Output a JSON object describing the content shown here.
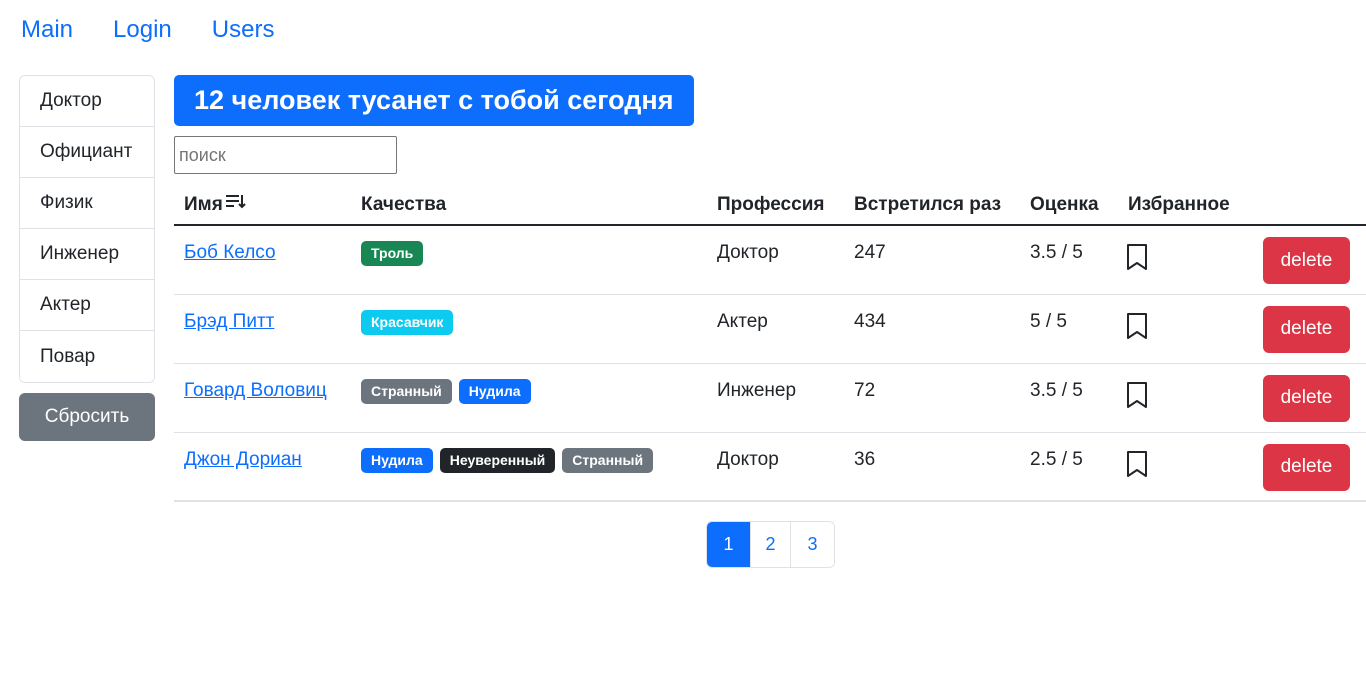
{
  "nav": {
    "items": [
      "Main",
      "Login",
      "Users"
    ]
  },
  "sidebar": {
    "professions": [
      "Доктор",
      "Официант",
      "Физик",
      "Инженер",
      "Актер",
      "Повар"
    ],
    "reset_label": "Сбросить"
  },
  "headline": "12 человек тусанет с тобой сегодня",
  "search": {
    "placeholder": "поиск",
    "value": ""
  },
  "table": {
    "headers": {
      "name": "Имя",
      "qualities": "Качества",
      "profession": "Профессия",
      "met": "Встретился раз",
      "rate": "Оценка",
      "favorite": "Избранное"
    },
    "sort_icon": "sort-descending-icon",
    "rows": [
      {
        "name": "Боб Келсо",
        "qualities": [
          {
            "label": "Троль",
            "color": "#198754"
          }
        ],
        "profession": "Доктор",
        "met": "247",
        "rate": "3.5 / 5",
        "favorite_icon": "bookmark-icon",
        "delete_label": "delete"
      },
      {
        "name": "Брэд Питт",
        "qualities": [
          {
            "label": "Красавчик",
            "color": "#0dcaf0"
          }
        ],
        "profession": "Актер",
        "met": "434",
        "rate": "5 / 5",
        "favorite_icon": "bookmark-icon",
        "delete_label": "delete"
      },
      {
        "name": "Говард Воловиц",
        "qualities": [
          {
            "label": "Странный",
            "color": "#6c757d"
          },
          {
            "label": "Нудила",
            "color": "#0d6efd"
          }
        ],
        "profession": "Инженер",
        "met": "72",
        "rate": "3.5 / 5",
        "favorite_icon": "bookmark-icon",
        "delete_label": "delete"
      },
      {
        "name": "Джон Дориан",
        "qualities": [
          {
            "label": "Нудила",
            "color": "#0d6efd"
          },
          {
            "label": "Неуверенный",
            "color": "#212529"
          },
          {
            "label": "Странный",
            "color": "#6c757d"
          }
        ],
        "profession": "Доктор",
        "met": "36",
        "rate": "2.5 / 5",
        "favorite_icon": "bookmark-icon",
        "delete_label": "delete"
      }
    ]
  },
  "pagination": {
    "pages": [
      "1",
      "2",
      "3"
    ],
    "active": "1"
  },
  "colors": {
    "primary": "#0d6efd",
    "danger": "#dc3545",
    "secondary": "#6c757d"
  }
}
